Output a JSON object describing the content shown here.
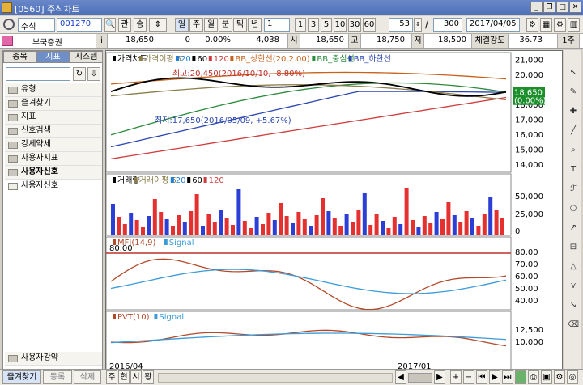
{
  "window": {
    "title": "[0560] 주식차트",
    "icons": [
      "help-icon",
      "question-icon"
    ]
  },
  "toolbar": {
    "market": "주식",
    "code": "001270",
    "buttons": [
      "관",
      "송"
    ],
    "period_buttons": [
      "일",
      "주",
      "월",
      "분",
      "틱",
      "년"
    ],
    "minute_value": "1",
    "intervals": [
      "1",
      "3",
      "5",
      "10",
      "30",
      "60"
    ],
    "count": "53",
    "total": "300",
    "slash": "/",
    "date": "2017/04/05"
  },
  "quote": {
    "name": "부국증권",
    "info": "i",
    "price": "18,650",
    "change": "0",
    "rate": "0.00%",
    "volume": "4,038",
    "open_label": "시",
    "open": "18,650",
    "high_label": "고",
    "high": "18,750",
    "low_label": "저",
    "low": "18,500",
    "strength_label": "체결강도",
    "strength": "36.73",
    "unit": "1주"
  },
  "sidebar": {
    "tabs": [
      "종목",
      "지표",
      "시스템"
    ],
    "items": [
      "유형",
      "즐겨찾기",
      "지표",
      "신호검색",
      "강세약세",
      "사용자지표",
      "사용자신호",
      "사용자신호"
    ],
    "bottom_item": "사용자강약",
    "footer_buttons": [
      "즐겨찾기",
      "등록",
      "삭제"
    ]
  },
  "chart": {
    "legend1": [
      "가격차트",
      "가격이평 5",
      "20",
      "60",
      "120",
      "BB_상한선(20,2.00)",
      "BB_중심선",
      "BB_하한선"
    ],
    "high_annotation": "최고:20,450(2016/10/10, -8.80%)",
    "low_annotation": "최저:17,650(2016/05/09, +5.67%)",
    "price_axis": [
      "21,000",
      "20,000",
      "19,000",
      "18,000",
      "17,000",
      "16,000",
      "15,000",
      "14,000"
    ],
    "current_price": "18,650",
    "current_change": "(0.00%)",
    "legend2": [
      "거래량",
      "거래이평 5",
      "20",
      "60",
      "120"
    ],
    "volume_axis": [
      "50,000",
      "25,000",
      "0"
    ],
    "legend3": [
      "MFI(14,9)",
      "Signal"
    ],
    "mfi_level": "80.00",
    "mfi_axis": [
      "80.00",
      "70.00",
      "60.00",
      "50.00",
      "40.00"
    ],
    "legend4": [
      "PVT(10)",
      "Signal"
    ],
    "pvt_axis": [
      "12,500",
      "10,000"
    ],
    "dates": [
      "2016/04",
      "2017/01"
    ],
    "colors": {
      "price": "#000000",
      "ma5": "#8b7d4a",
      "ma20": "#1f7fd8",
      "ma60": "#000000",
      "ma120": "#d03a3a",
      "bb_upper": "#c8621b",
      "bb_mid": "#2a8a3a",
      "bb_lower": "#2a46b0",
      "up": "#e53030",
      "down": "#2b3fd6"
    }
  },
  "bottom": {
    "tabs": [
      "주",
      "현",
      "시",
      "황"
    ]
  },
  "tools": [
    "cursor-icon",
    "pencil-icon",
    "crosshair-icon",
    "line-icon",
    "zoom-icon",
    "text-icon",
    "fibonacci-icon",
    "circle-icon",
    "trend-icon",
    "ruler-icon",
    "triangle-icon",
    "fan-icon",
    "arrow-icon",
    "eraser-icon"
  ]
}
